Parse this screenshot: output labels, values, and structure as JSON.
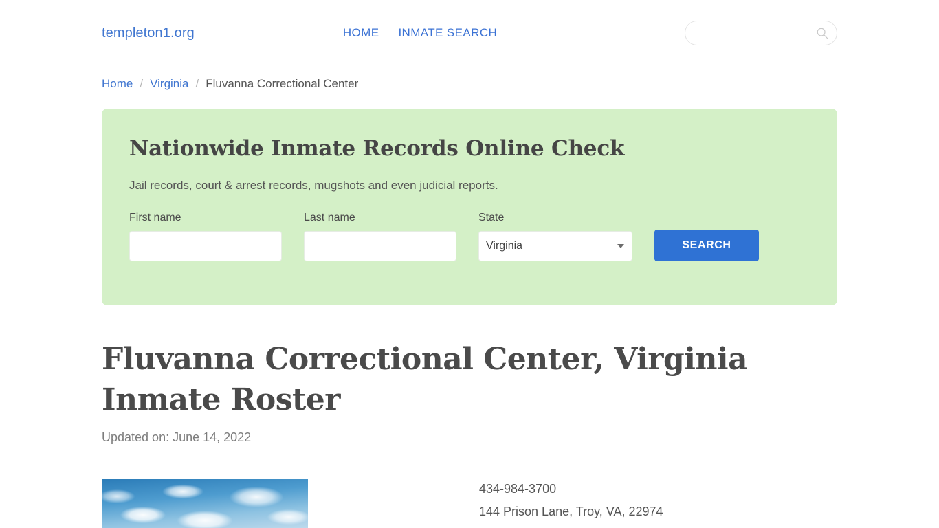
{
  "header": {
    "logo": "templeton1.org",
    "nav": [
      {
        "label": "HOME"
      },
      {
        "label": "INMATE SEARCH"
      }
    ],
    "search": {
      "value": "",
      "placeholder": ""
    }
  },
  "breadcrumb": {
    "items": [
      {
        "label": "Home",
        "link": true
      },
      {
        "label": "Virginia",
        "link": true
      },
      {
        "label": "Fluvanna Correctional Center",
        "link": false
      }
    ],
    "separator": "/"
  },
  "panel": {
    "title": "Nationwide Inmate Records Online Check",
    "subtitle": "Jail records, court & arrest records, mugshots and even judicial reports.",
    "fields": {
      "first_name_label": "First name",
      "first_name_value": "",
      "first_name_placeholder": "",
      "last_name_label": "Last name",
      "last_name_value": "",
      "last_name_placeholder": "",
      "state_label": "State",
      "state_value": "Virginia"
    },
    "search_button": "SEARCH",
    "background_color": "#d4f0c7"
  },
  "article": {
    "title": "Fluvanna Correctional Center, Virginia Inmate Roster",
    "updated": "Updated on: June 14, 2022"
  },
  "facility": {
    "phone": "434-984-3700",
    "address": "144 Prison Lane, Troy, VA, 22974"
  },
  "colors": {
    "link": "#4076d0",
    "nav_link": "#3b72d4",
    "button": "#2f72d4",
    "panel": "#d4f0c7",
    "heading": "#4a4a4a"
  }
}
